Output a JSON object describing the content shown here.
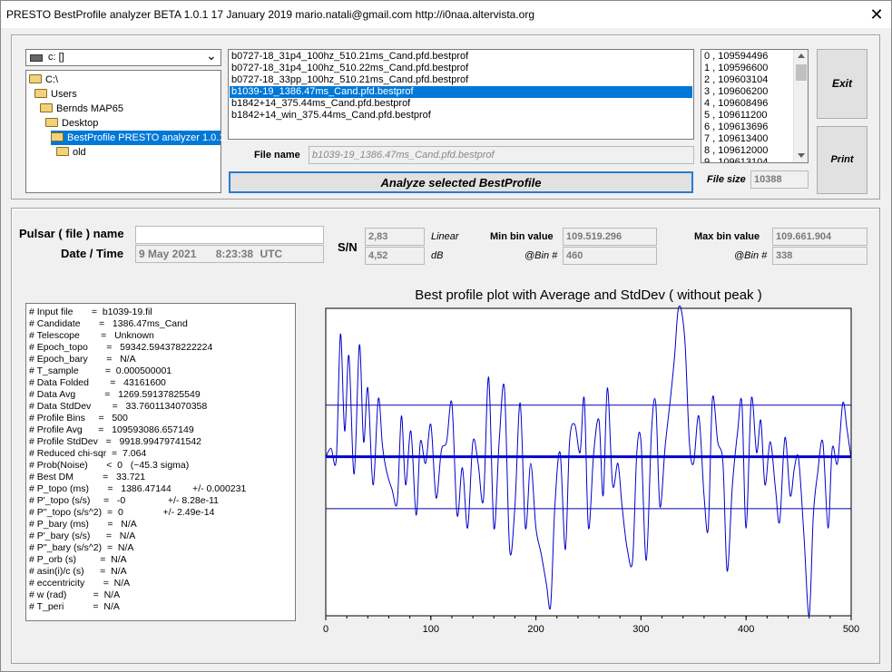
{
  "window": {
    "title": "PRESTO BestProfile analyzer BETA 1.0.1   17 January 2019      mario.natali@gmail.com      http://i0naa.altervista.org",
    "close_glyph": "✕"
  },
  "drive": {
    "value": "c: []",
    "arrow": "⌄"
  },
  "tree": {
    "items": [
      {
        "label": "C:\\",
        "indent": 0,
        "selected": false
      },
      {
        "label": "Users",
        "indent": 1,
        "selected": false
      },
      {
        "label": "Bernds MAP65",
        "indent": 2,
        "selected": false
      },
      {
        "label": "Desktop",
        "indent": 3,
        "selected": false
      },
      {
        "label": "BestProfile PRESTO analyzer 1.0.1.e",
        "indent": 4,
        "selected": true
      },
      {
        "label": "old",
        "indent": 5,
        "selected": false
      }
    ]
  },
  "files": {
    "items": [
      "b0727-18_31p4_100hz_510.21ms_Cand.pfd.bestprof",
      "b0727-18_31p4_100hz_510.22ms_Cand.pfd.bestprof",
      "b0727-18_33pp_100hz_510.21ms_Cand.pfd.bestprof",
      "b1039-19_1386.47ms_Cand.pfd.bestprof",
      "b1842+14_375.44ms_Cand.pfd.bestprof",
      "b1842+14_win_375.44ms_Cand.pfd.bestprof"
    ],
    "selected_index": 3
  },
  "filename": {
    "label": "File name",
    "value": "b1039-19_1386.47ms_Cand.pfd.bestprof"
  },
  "analyze_button": "Analyze selected BestProfile",
  "filesize": {
    "label": "File size",
    "value": "10388"
  },
  "values_list": [
    "0  ,  109594496",
    "1  ,  109596600",
    "2  ,  109603104",
    "3  ,  109606200",
    "4  ,  109608496",
    "5  ,  109611200",
    "6  ,  109613696",
    "7  ,  109613400",
    "8  ,  109612000",
    "9  ,  109613104"
  ],
  "buttons": {
    "exit": "Exit",
    "print": "Print"
  },
  "pulsar": {
    "name_label": "Pulsar ( file ) name",
    "name_value": "",
    "datetime_label": "Date / Time",
    "date_value": "9 May 2021",
    "time_value": "8:23:38",
    "tz": "UTC"
  },
  "sn": {
    "label": "S/N",
    "linear_value": "2,83",
    "linear_label": "Linear",
    "db_value": "4,52",
    "db_label": "dB"
  },
  "minbin": {
    "label": "Min bin value",
    "value": "109.519.296",
    "bin_label": "@Bin #",
    "bin_value": "460"
  },
  "maxbin": {
    "label": "Max bin value",
    "value": "109.661.904",
    "bin_label": "@Bin #",
    "bin_value": "338"
  },
  "info_lines": [
    "# Input file       =  b1039-19.fil",
    "# Candidate       =   1386.47ms_Cand",
    "# Telescope        =   Unknown",
    "# Epoch_topo       =   59342.594378222224",
    "# Epoch_bary       =   N/A",
    "# T_sample          =  0.000500001",
    "# Data Folded        =   43161600",
    "# Data Avg           =   1269.59137825549",
    "# Data StdDev        =   33.7601134070358",
    "# Profile Bins     =   500",
    "# Profile Avg      =   109593086.657149",
    "# Profile StdDev   =   9918.99479741542",
    "# Reduced chi-sqr  =  7.064",
    "# Prob(Noise)       <  0   (~45.3 sigma)",
    "# Best DM           =   33.721",
    "# P_topo (ms)       =   1386.47144        +/- 0.000231",
    "# P'_topo (s/s)     =   -0                +/- 8.28e-11",
    "# P''_topo (s/s^2)  =  0               +/- 2.49e-14",
    "# P_bary (ms)       =   N/A",
    "# P'_bary (s/s)      =   N/A",
    "# P''_bary (s/s^2)  =  N/A",
    "# P_orb (s)         =  N/A",
    "# asin(i)/c (s)      =  N/A",
    "# eccentricity       =  N/A",
    "# w (rad)          =  N/A",
    "# T_peri           =  N/A"
  ],
  "chart_data": {
    "type": "line",
    "title": "Best profile plot with  Average and StdDev ( without peak )",
    "xlim": [
      0,
      500
    ],
    "x_ticks": [
      0,
      100,
      200,
      300,
      400,
      500
    ],
    "ylim": [
      109519296,
      109661904
    ],
    "series": [
      {
        "x": [
          0,
          5,
          10,
          14,
          18,
          22,
          27,
          32,
          36,
          40,
          45,
          50,
          54,
          58,
          63,
          68,
          72,
          76,
          81,
          86,
          90,
          95,
          100,
          105,
          110,
          115,
          120,
          125,
          130,
          135,
          140,
          145,
          150,
          155,
          160,
          165,
          170,
          175,
          180,
          185,
          190,
          195,
          200,
          205,
          210,
          214,
          218,
          223,
          228,
          232,
          237,
          242,
          246,
          250,
          255,
          260,
          264,
          268,
          273,
          278,
          282,
          287,
          292,
          296,
          300,
          305,
          310,
          314,
          318,
          323,
          328,
          332,
          335,
          338,
          342,
          346,
          350,
          355,
          360,
          364,
          368,
          373,
          378,
          382,
          387,
          392,
          396,
          400,
          405,
          410,
          414,
          418,
          423,
          428,
          432,
          437,
          442,
          446,
          450,
          455,
          460,
          464,
          468,
          473,
          478,
          482,
          487,
          492,
          496,
          500
        ],
        "y": [
          109593000,
          109597000,
          109592000,
          109650000,
          109605000,
          109640000,
          109585000,
          109645000,
          109600000,
          109625000,
          109580000,
          109620000,
          109598000,
          109586000,
          109578000,
          109572000,
          109612000,
          109580000,
          109605000,
          109566000,
          109600000,
          109590000,
          109608000,
          109574000,
          109596000,
          109600000,
          109618000,
          109566000,
          109588000,
          109560000,
          109600000,
          109590000,
          109573000,
          109630000,
          109560000,
          109600000,
          109625000,
          109550000,
          109570000,
          109618000,
          109560000,
          109590000,
          109560000,
          109548000,
          109534000,
          109524000,
          109570000,
          109595000,
          109550000,
          109600000,
          109608000,
          109595000,
          109620000,
          109560000,
          109595000,
          109610000,
          109575000,
          109625000,
          109580000,
          109590000,
          109570000,
          109550000,
          109545000,
          109595000,
          109600000,
          109545000,
          109605000,
          109618000,
          109570000,
          109598000,
          109620000,
          109640000,
          109660000,
          109661904,
          109645000,
          109600000,
          109590000,
          109612000,
          109575000,
          109560000,
          109620000,
          109600000,
          109590000,
          109540000,
          109580000,
          109605000,
          109618000,
          109560000,
          109620000,
          109595000,
          109610000,
          109580000,
          109600000,
          109578000,
          109563000,
          109602000,
          109575000,
          109588000,
          109592000,
          109557000,
          109519296,
          109566000,
          109585000,
          109600000,
          109560000,
          109597000,
          109590000,
          109618000,
          109606000,
          109592000
        ]
      }
    ],
    "avg": 109593086.657149,
    "stddev_upper": 109617000,
    "stddev_lower": 109569000
  }
}
